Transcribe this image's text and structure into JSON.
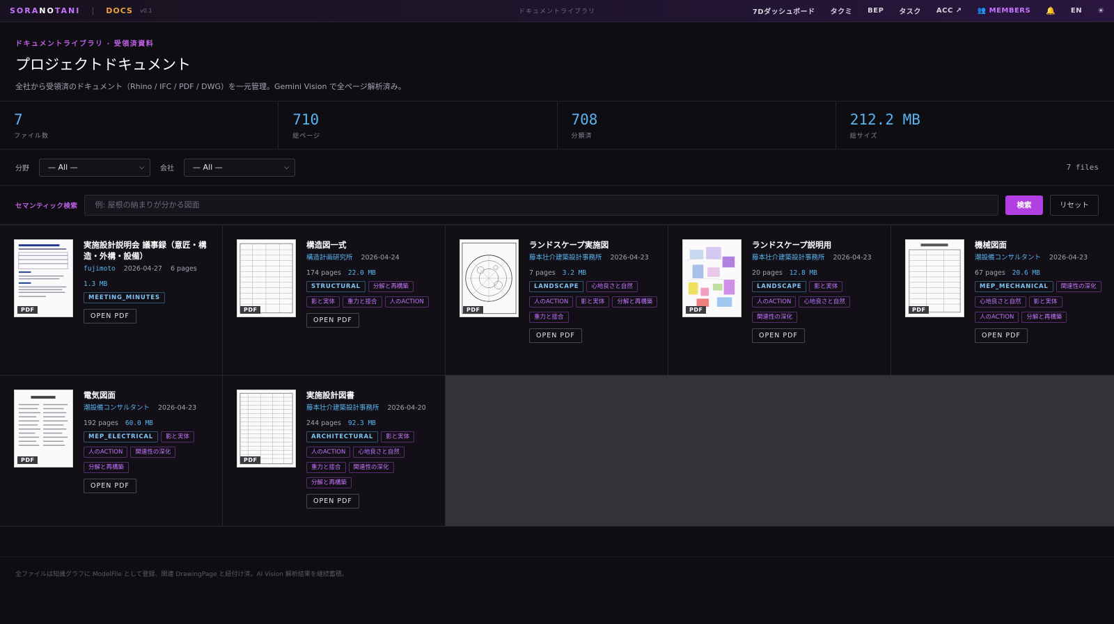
{
  "topbar": {
    "brand_a": "SORANOTANI",
    "brand_part1": "SORA",
    "brand_part2": "NO",
    "brand_part3": "TANI",
    "section": "DOCS",
    "version": "v0.1",
    "center_title": "ドキュメントライブラリ",
    "nav": [
      "7Dダッシュボード",
      "タクミ",
      "BEP",
      "タスク",
      "ACC ↗",
      "MEMBERS"
    ],
    "lang": "EN"
  },
  "header": {
    "breadcrumb": "ドキュメントライブラリ · 受領済資料",
    "title": "プロジェクトドキュメント",
    "subtitle": "全社から受領済のドキュメント（Rhino / IFC / PDF / DWG）を一元管理。Gemini Vision で全ページ解析済み。"
  },
  "stats": [
    {
      "value": "7",
      "label": "ファイル数"
    },
    {
      "value": "710",
      "label": "総ページ"
    },
    {
      "value": "708",
      "label": "分類済"
    },
    {
      "value": "212.2 MB",
      "label": "総サイズ"
    }
  ],
  "filters": {
    "field_label": "分野",
    "field_value": "— All —",
    "company_label": "会社",
    "company_value": "— All —",
    "count": "7 files"
  },
  "search": {
    "label": "セマンティック検索",
    "placeholder": "例: 屋根の納まりが分かる図面",
    "submit": "検索",
    "reset": "リセット"
  },
  "open_label": "OPEN PDF",
  "pdf_label": "PDF",
  "documents": [
    {
      "title": "実施設計説明会 議事録（意匠・構造・外構・設備）",
      "author": "fujimoto",
      "date": "2026-04-27",
      "pages": "6 pages",
      "size": "1.3 MB",
      "category": "MEETING_MINUTES",
      "tags": []
    },
    {
      "title": "構造図一式",
      "org": "構造計画研究所",
      "date": "2026-04-24",
      "pages": "174 pages",
      "size": "22.0 MB",
      "category": "STRUCTURAL",
      "tags": [
        "分解と再構築",
        "影と実体",
        "重力と接合",
        "人のACTION"
      ]
    },
    {
      "title": "ランドスケープ実施図",
      "org": "藤本壮介建築設計事務所",
      "date": "2026-04-23",
      "pages": "7 pages",
      "size": "3.2 MB",
      "category": "LANDSCAPE",
      "tags": [
        "心地良さと自然",
        "人のACTION",
        "影と実体",
        "分解と再構築",
        "重力と接合"
      ]
    },
    {
      "title": "ランドスケープ説明用",
      "org": "藤本壮介建築設計事務所",
      "date": "2026-04-23",
      "pages": "20 pages",
      "size": "12.8 MB",
      "category": "LANDSCAPE",
      "tags": [
        "影と実体",
        "人のACTION",
        "心地良さと自然",
        "関連性の深化"
      ]
    },
    {
      "title": "機械図面",
      "org": "潮設備コンサルタント",
      "date": "2026-04-23",
      "pages": "67 pages",
      "size": "20.6 MB",
      "category": "MEP_MECHANICAL",
      "tags": [
        "関連性の深化",
        "心地良さと自然",
        "影と実体",
        "人のACTION",
        "分解と再構築"
      ]
    },
    {
      "title": "電気図面",
      "org": "潮設備コンサルタント",
      "date": "2026-04-23",
      "pages": "192 pages",
      "size": "60.0 MB",
      "category": "MEP_ELECTRICAL",
      "tags": [
        "影と実体",
        "人のACTION",
        "関連性の深化",
        "分解と再構築"
      ]
    },
    {
      "title": "実施設計図書",
      "org": "藤本壮介建築設計事務所",
      "date": "2026-04-20",
      "pages": "244 pages",
      "size": "92.3 MB",
      "category": "ARCHITECTURAL",
      "tags": [
        "影と実体",
        "人のACTION",
        "心地良さと自然",
        "重力と接合",
        "関連性の深化",
        "分解と再構築"
      ]
    }
  ],
  "footer": "全ファイルは知識グラフに ModelFile として登録、関連 DrawingPage と紐付け済。AI Vision 解析結果を継続蓄積。"
}
